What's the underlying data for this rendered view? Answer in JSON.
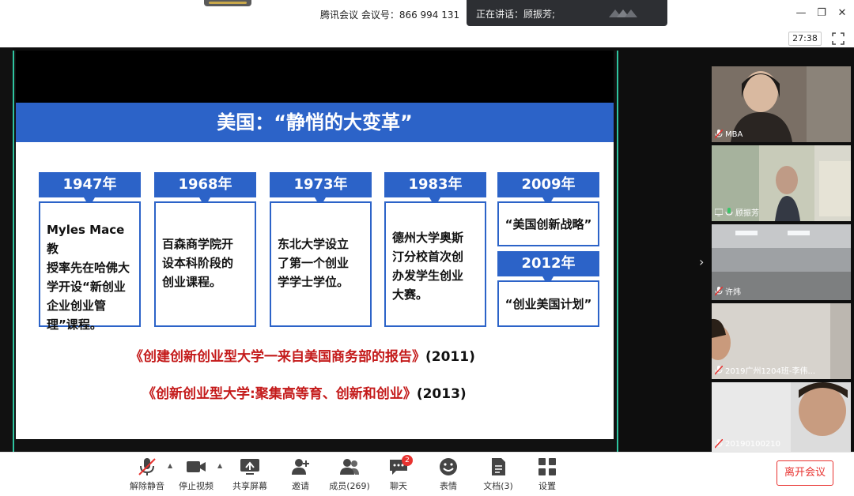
{
  "window": {
    "title": "腾讯会议  会议号：866 994 131",
    "speaking": "正在讲话：顾振芳;",
    "timer": "27:38",
    "controls": {
      "minimize": "—",
      "restore": "❐",
      "close": "✕"
    }
  },
  "slide": {
    "title": "美国：“静悄的大变革”",
    "timeline": [
      {
        "year": "1947年",
        "lines": [
          "Myles Mace教",
          "授率先在哈佛大",
          "学开设“新创业",
          "企业创业管",
          "理”课程。"
        ]
      },
      {
        "year": "1968年",
        "lines": [
          "百森商学院开",
          "设本科阶段的",
          "创业课程。"
        ]
      },
      {
        "year": "1973年",
        "lines": [
          "东北大学设立",
          "了第一个创业",
          "学学士学位。"
        ]
      },
      {
        "year": "1983年",
        "lines": [
          "德州大学奥斯",
          "汀分校首次创",
          "办发学生创业",
          "大赛。"
        ]
      },
      {
        "year": "2009年",
        "lines": [
          "“美国创新战略”"
        ]
      },
      {
        "year": "2012年",
        "lines": [
          "“创业美国计划”"
        ]
      }
    ],
    "references": [
      {
        "title": "《创建创新创业型大学一来自美国商务部的报告》",
        "year": "(2011)"
      },
      {
        "title": "《创新创业型大学:聚集高等育、创新和创业》",
        "year": "(2013)"
      }
    ],
    "colors": {
      "accent": "#2c63c8",
      "ref_red": "#c41a1a"
    }
  },
  "participants": [
    {
      "name": "MBA"
    },
    {
      "name": "顾振芳"
    },
    {
      "name": "许炜"
    },
    {
      "name": "2019广州1204班-李伟..."
    },
    {
      "name": "20190100210"
    }
  ],
  "toolbar": {
    "mute": "解除静音",
    "video": "停止视频",
    "share": "共享屏幕",
    "invite": "邀请",
    "members": "成员(269)",
    "chat": "聊天",
    "chat_badge": "2",
    "emoji": "表情",
    "docs": "文档(3)",
    "settings": "设置",
    "leave": "离开会议"
  }
}
